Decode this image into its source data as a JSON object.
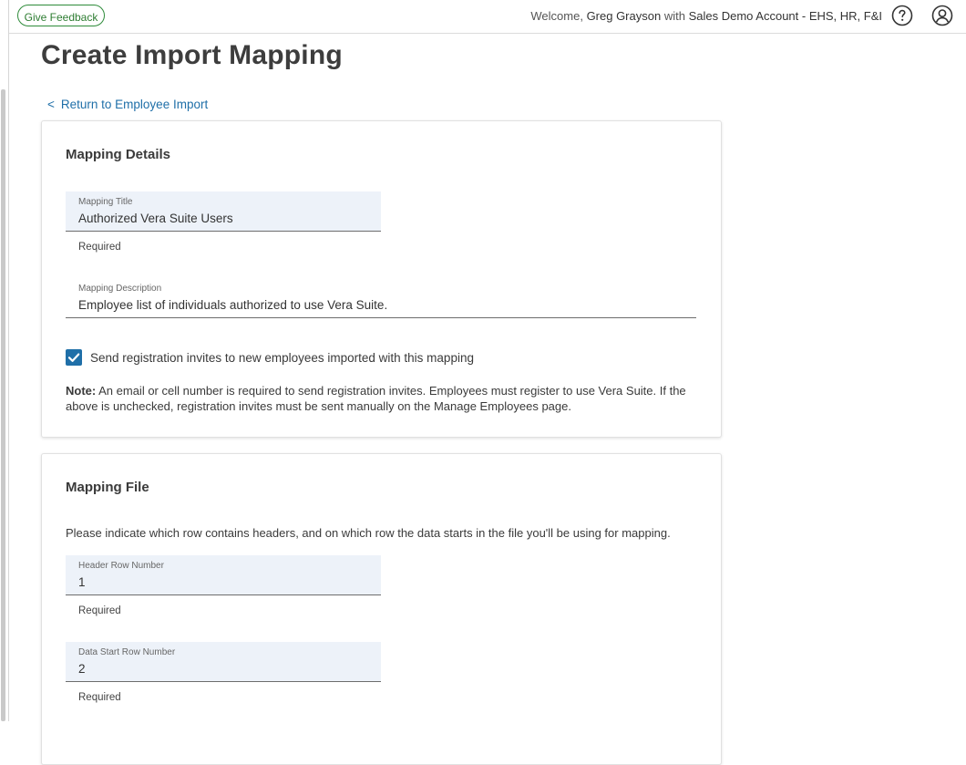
{
  "header": {
    "feedback_label": "Give Feedback",
    "welcome_prefix": "Welcome,",
    "user_name": "Greg Grayson",
    "with_word": "with",
    "account_name": "Sales Demo Account - EHS, HR, F&I",
    "help_icon": "question-circle-icon",
    "user_icon": "user-circle-icon"
  },
  "page": {
    "title": "Create Import Mapping",
    "back_chevron": "<",
    "back_link": "Return to Employee Import"
  },
  "mapping_details": {
    "title": "Mapping Details",
    "mapping_title": {
      "label": "Mapping Title",
      "value": "Authorized Vera Suite Users",
      "helper": "Required"
    },
    "mapping_description": {
      "label": "Mapping Description",
      "value": "Employee list of individuals authorized to use Vera Suite."
    },
    "send_invites": {
      "checked": true,
      "label": "Send registration invites to new employees imported with this mapping"
    },
    "note": {
      "prefix": "Note:",
      "text": "An email or cell number is required to send registration invites. Employees must register to use Vera Suite. If the above is unchecked, registration invites must be sent manually on the Manage Employees page."
    }
  },
  "mapping_file": {
    "title": "Mapping File",
    "instructions": "Please indicate which row contains headers, and on which row the data starts in the file you'll be using for mapping.",
    "header_row": {
      "label": "Header Row Number",
      "value": "1",
      "helper": "Required"
    },
    "data_start_row": {
      "label": "Data Start Row Number",
      "value": "2",
      "helper": "Required"
    }
  },
  "colors": {
    "accent": "#1f6fa8",
    "feedback_green": "#2e7d32",
    "field_bg": "#edf2f9"
  }
}
